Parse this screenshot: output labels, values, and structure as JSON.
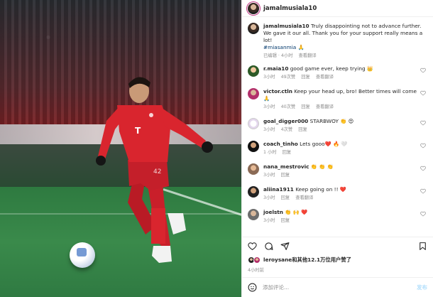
{
  "post": {
    "username": "jamalmusiala10",
    "caption_text": "Truly disappointing not to advance further. We gave it our all. Thank you for your support really means a lot!",
    "hashtag": "#miasanmia 🙏",
    "caption_meta": {
      "edited": "已编辑 · 4小时",
      "translate": "查看翻译"
    }
  },
  "comments": [
    {
      "user": "r.maia10",
      "text": "good game ever, keep trying 👑",
      "time": "3小时",
      "likes": "49次赞",
      "reply": "回复",
      "translate": "查看翻译"
    },
    {
      "user": "victor.ctln",
      "text": "Keep your head up, bro! Better times will come 🙏",
      "time": "3小时",
      "likes": "40次赞",
      "reply": "回复",
      "translate": "查看翻译"
    },
    {
      "user": "goal_digger000",
      "text": "STARBWOY 👏 😍",
      "time": "3小时",
      "likes": "4次赞",
      "reply": "回复",
      "translate": ""
    },
    {
      "user": "coach_tinho",
      "text": "Lets gooo❤️ 🔥 🤍",
      "time": "1 小时",
      "likes": "",
      "reply": "回复",
      "translate": ""
    },
    {
      "user": "nana_mestrovic",
      "text": "👏 👏 👏",
      "time": "3小时",
      "likes": "",
      "reply": "回复",
      "translate": ""
    },
    {
      "user": "aliina1911",
      "text": "Keep going on !! ❤️",
      "time": "3小时",
      "likes": "",
      "reply": "回复",
      "translate": "查看翻译"
    },
    {
      "user": "joelstn",
      "text": "👏 🙌 ❤️",
      "time": "3小时",
      "likes": "",
      "reply": "回复",
      "translate": ""
    }
  ],
  "likes_line": {
    "user": "leroysane",
    "rest": "和其他12.1万位用户赞了"
  },
  "post_time": "4小时前",
  "add_comment": {
    "placeholder": "添加评论...",
    "post_label": "发布"
  },
  "icons": [
    "heart-icon",
    "comment-icon",
    "share-icon",
    "bookmark-icon",
    "emoji-icon"
  ],
  "colors": {
    "jersey_red": "#d9252e",
    "pitch_green": "#2f7a42",
    "link_blue": "#00376b"
  }
}
